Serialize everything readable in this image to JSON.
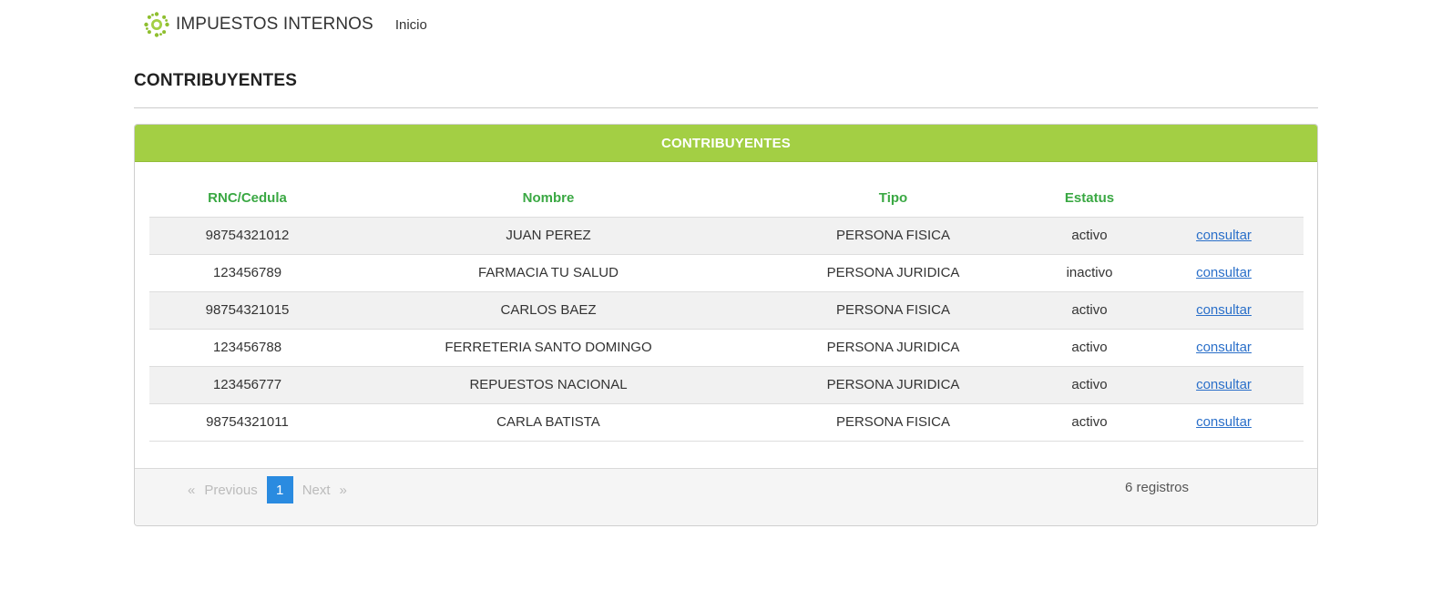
{
  "nav": {
    "brand": "IMPUESTOS INTERNOS",
    "brand_icon": "sun-logo-icon",
    "accent_logo_color": "#a3cf44",
    "links": [
      {
        "label": "Inicio"
      }
    ]
  },
  "page": {
    "title": "CONTRIBUYENTES"
  },
  "panel": {
    "heading": "CONTRIBUYENTES",
    "heading_color": "#a3cf44",
    "columns": [
      "RNC/Cedula",
      "Nombre",
      "Tipo",
      "Estatus",
      ""
    ],
    "rows": [
      {
        "rnc": "98754321012",
        "nombre": "JUAN PEREZ",
        "tipo": "PERSONA FISICA",
        "estatus": "activo",
        "action": "consultar"
      },
      {
        "rnc": "123456789",
        "nombre": "FARMACIA TU SALUD",
        "tipo": "PERSONA JURIDICA",
        "estatus": "inactivo",
        "action": "consultar"
      },
      {
        "rnc": "98754321015",
        "nombre": "CARLOS BAEZ",
        "tipo": "PERSONA FISICA",
        "estatus": "activo",
        "action": "consultar"
      },
      {
        "rnc": "123456788",
        "nombre": "FERRETERIA SANTO DOMINGO",
        "tipo": "PERSONA JURIDICA",
        "estatus": "activo",
        "action": "consultar"
      },
      {
        "rnc": "123456777",
        "nombre": "REPUESTOS NACIONAL",
        "tipo": "PERSONA JURIDICA",
        "estatus": "activo",
        "action": "consultar"
      },
      {
        "rnc": "98754321011",
        "nombre": "CARLA BATISTA",
        "tipo": "PERSONA FISICA",
        "estatus": "activo",
        "action": "consultar"
      }
    ]
  },
  "pagination": {
    "first_symbol": "«",
    "previous_label": "Previous",
    "current_page": "1",
    "next_label": "Next",
    "last_symbol": "»",
    "records_text": "6 registros"
  }
}
